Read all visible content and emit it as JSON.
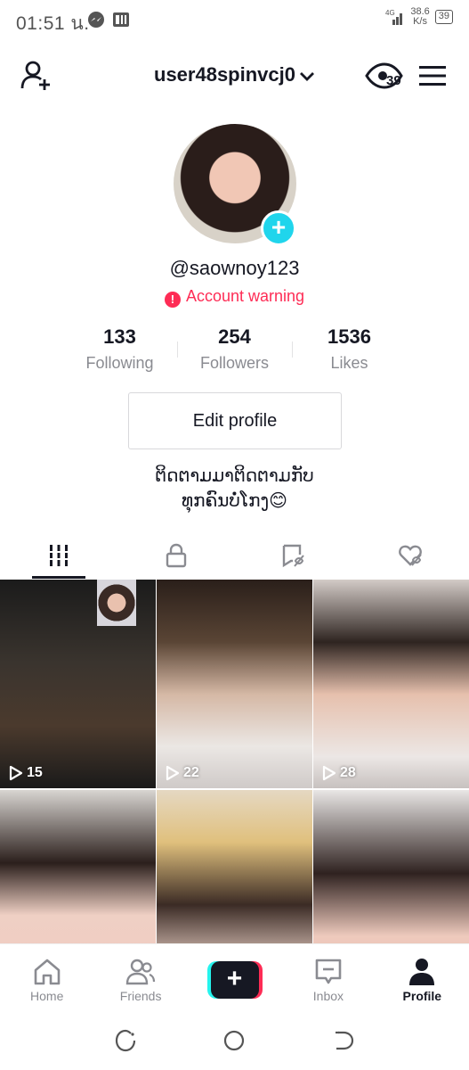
{
  "status_bar": {
    "time": "01:51 น.",
    "network_type": "4G",
    "speed_value": "38.6",
    "speed_unit": "K/s",
    "battery": "39"
  },
  "header": {
    "username": "user48spinvcj0",
    "profile_views_count": "39"
  },
  "profile": {
    "handle": "@saownoy123",
    "warning_text": "Account warning",
    "stats": [
      {
        "value": "133",
        "label": "Following"
      },
      {
        "value": "254",
        "label": "Followers"
      },
      {
        "value": "1536",
        "label": "Likes"
      }
    ],
    "edit_profile_label": "Edit profile",
    "bio_line1": "ຕິດຕາມມາຕິດຕາມກັບ",
    "bio_line2": "ທຸກຄົນບໍ່ໂກງ😊"
  },
  "tabs": [
    "videos-icon",
    "lock-icon",
    "tagged-icon",
    "liked-icon"
  ],
  "videos": [
    {
      "views": "15"
    },
    {
      "views": "22"
    },
    {
      "views": "28"
    },
    {
      "views": ""
    },
    {
      "views": ""
    },
    {
      "views": ""
    }
  ],
  "bottom_nav": {
    "home": "Home",
    "friends": "Friends",
    "inbox": "Inbox",
    "profile": "Profile"
  },
  "colors": {
    "accent_red": "#fe2c55",
    "accent_cyan": "#20d5ec"
  }
}
